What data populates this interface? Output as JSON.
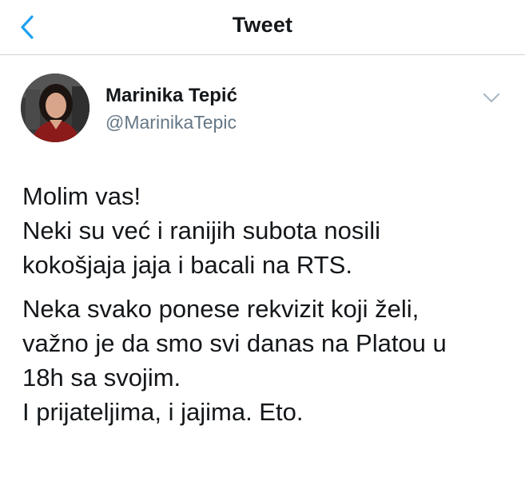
{
  "header": {
    "title": "Tweet",
    "back_icon": "chevron-left-icon",
    "accent_color": "#1da1f2"
  },
  "tweet": {
    "author_name": "Marinika Tepić",
    "author_handle": "@MarinikaTepic",
    "menu_icon": "chevron-down-icon",
    "paragraphs": [
      {
        "lines": [
          "Molim vas!",
          "Neki su već i ranijih subota nosili",
          "kokošjaja jaja i bacali na RTS."
        ]
      },
      {
        "lines": [
          "Neka svako ponese rekvizit koji želi,",
          "važno je da smo svi danas na Platou u",
          "18h sa svojim.",
          "I prijateljima, i jajima. Eto."
        ]
      }
    ]
  }
}
